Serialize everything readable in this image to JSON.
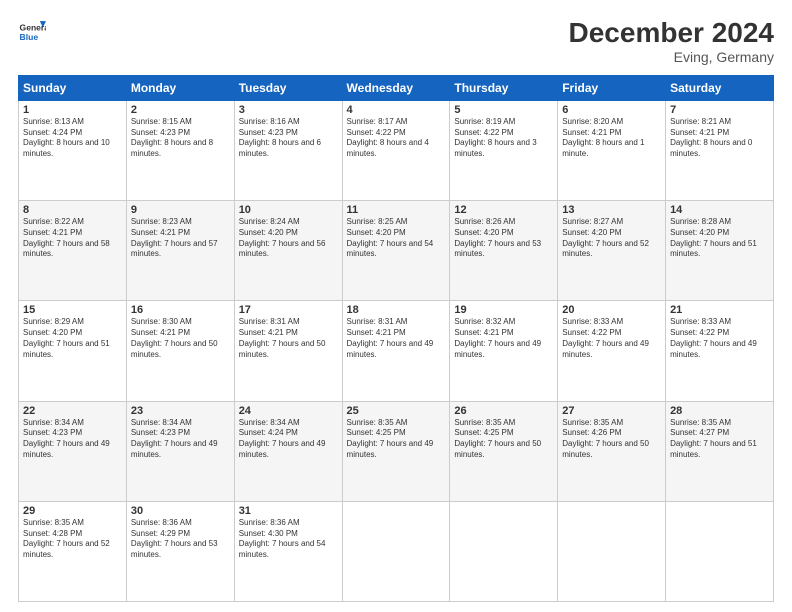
{
  "logo": {
    "line1": "General",
    "line2": "Blue"
  },
  "title": "December 2024",
  "subtitle": "Eving, Germany",
  "days_header": [
    "Sunday",
    "Monday",
    "Tuesday",
    "Wednesday",
    "Thursday",
    "Friday",
    "Saturday"
  ],
  "weeks": [
    [
      {
        "day": "1",
        "sunrise": "8:13 AM",
        "sunset": "4:24 PM",
        "daylight": "8 hours and 10 minutes."
      },
      {
        "day": "2",
        "sunrise": "8:15 AM",
        "sunset": "4:23 PM",
        "daylight": "8 hours and 8 minutes."
      },
      {
        "day": "3",
        "sunrise": "8:16 AM",
        "sunset": "4:23 PM",
        "daylight": "8 hours and 6 minutes."
      },
      {
        "day": "4",
        "sunrise": "8:17 AM",
        "sunset": "4:22 PM",
        "daylight": "8 hours and 4 minutes."
      },
      {
        "day": "5",
        "sunrise": "8:19 AM",
        "sunset": "4:22 PM",
        "daylight": "8 hours and 3 minutes."
      },
      {
        "day": "6",
        "sunrise": "8:20 AM",
        "sunset": "4:21 PM",
        "daylight": "8 hours and 1 minute."
      },
      {
        "day": "7",
        "sunrise": "8:21 AM",
        "sunset": "4:21 PM",
        "daylight": "8 hours and 0 minutes."
      }
    ],
    [
      {
        "day": "8",
        "sunrise": "8:22 AM",
        "sunset": "4:21 PM",
        "daylight": "7 hours and 58 minutes."
      },
      {
        "day": "9",
        "sunrise": "8:23 AM",
        "sunset": "4:21 PM",
        "daylight": "7 hours and 57 minutes."
      },
      {
        "day": "10",
        "sunrise": "8:24 AM",
        "sunset": "4:20 PM",
        "daylight": "7 hours and 56 minutes."
      },
      {
        "day": "11",
        "sunrise": "8:25 AM",
        "sunset": "4:20 PM",
        "daylight": "7 hours and 54 minutes."
      },
      {
        "day": "12",
        "sunrise": "8:26 AM",
        "sunset": "4:20 PM",
        "daylight": "7 hours and 53 minutes."
      },
      {
        "day": "13",
        "sunrise": "8:27 AM",
        "sunset": "4:20 PM",
        "daylight": "7 hours and 52 minutes."
      },
      {
        "day": "14",
        "sunrise": "8:28 AM",
        "sunset": "4:20 PM",
        "daylight": "7 hours and 51 minutes."
      }
    ],
    [
      {
        "day": "15",
        "sunrise": "8:29 AM",
        "sunset": "4:20 PM",
        "daylight": "7 hours and 51 minutes."
      },
      {
        "day": "16",
        "sunrise": "8:30 AM",
        "sunset": "4:21 PM",
        "daylight": "7 hours and 50 minutes."
      },
      {
        "day": "17",
        "sunrise": "8:31 AM",
        "sunset": "4:21 PM",
        "daylight": "7 hours and 50 minutes."
      },
      {
        "day": "18",
        "sunrise": "8:31 AM",
        "sunset": "4:21 PM",
        "daylight": "7 hours and 49 minutes."
      },
      {
        "day": "19",
        "sunrise": "8:32 AM",
        "sunset": "4:21 PM",
        "daylight": "7 hours and 49 minutes."
      },
      {
        "day": "20",
        "sunrise": "8:33 AM",
        "sunset": "4:22 PM",
        "daylight": "7 hours and 49 minutes."
      },
      {
        "day": "21",
        "sunrise": "8:33 AM",
        "sunset": "4:22 PM",
        "daylight": "7 hours and 49 minutes."
      }
    ],
    [
      {
        "day": "22",
        "sunrise": "8:34 AM",
        "sunset": "4:23 PM",
        "daylight": "7 hours and 49 minutes."
      },
      {
        "day": "23",
        "sunrise": "8:34 AM",
        "sunset": "4:23 PM",
        "daylight": "7 hours and 49 minutes."
      },
      {
        "day": "24",
        "sunrise": "8:34 AM",
        "sunset": "4:24 PM",
        "daylight": "7 hours and 49 minutes."
      },
      {
        "day": "25",
        "sunrise": "8:35 AM",
        "sunset": "4:25 PM",
        "daylight": "7 hours and 49 minutes."
      },
      {
        "day": "26",
        "sunrise": "8:35 AM",
        "sunset": "4:25 PM",
        "daylight": "7 hours and 50 minutes."
      },
      {
        "day": "27",
        "sunrise": "8:35 AM",
        "sunset": "4:26 PM",
        "daylight": "7 hours and 50 minutes."
      },
      {
        "day": "28",
        "sunrise": "8:35 AM",
        "sunset": "4:27 PM",
        "daylight": "7 hours and 51 minutes."
      }
    ],
    [
      {
        "day": "29",
        "sunrise": "8:35 AM",
        "sunset": "4:28 PM",
        "daylight": "7 hours and 52 minutes."
      },
      {
        "day": "30",
        "sunrise": "8:36 AM",
        "sunset": "4:29 PM",
        "daylight": "7 hours and 53 minutes."
      },
      {
        "day": "31",
        "sunrise": "8:36 AM",
        "sunset": "4:30 PM",
        "daylight": "7 hours and 54 minutes."
      },
      null,
      null,
      null,
      null
    ]
  ]
}
